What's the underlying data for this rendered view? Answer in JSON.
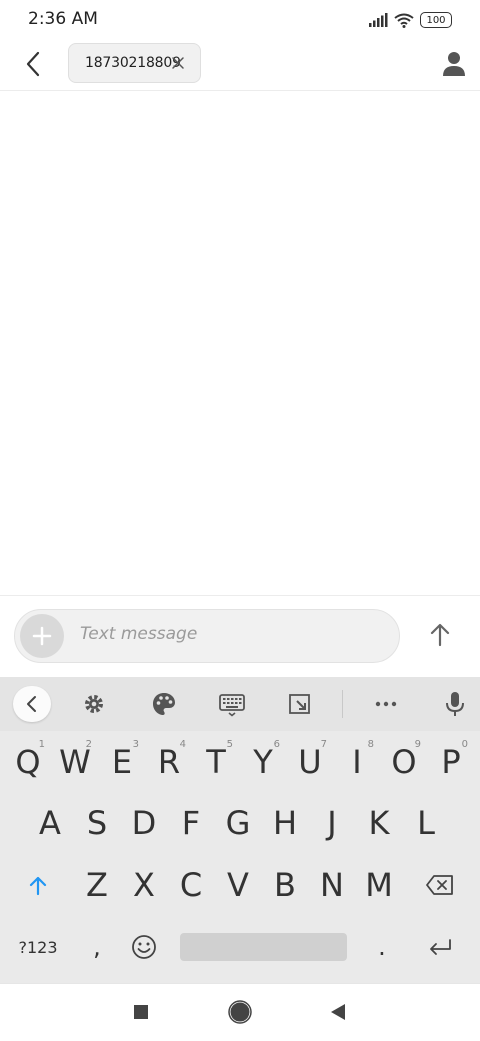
{
  "status_bar": {
    "time": "2:36 AM",
    "battery": "100"
  },
  "header": {
    "recipient": "18730218809"
  },
  "compose": {
    "placeholder": "Text message"
  },
  "keyboard": {
    "row1": [
      {
        "key": "Q",
        "hint": "1"
      },
      {
        "key": "W",
        "hint": "2"
      },
      {
        "key": "E",
        "hint": "3"
      },
      {
        "key": "R",
        "hint": "4"
      },
      {
        "key": "T",
        "hint": "5"
      },
      {
        "key": "Y",
        "hint": "6"
      },
      {
        "key": "U",
        "hint": "7"
      },
      {
        "key": "I",
        "hint": "8"
      },
      {
        "key": "O",
        "hint": "9"
      },
      {
        "key": "P",
        "hint": "0"
      }
    ],
    "row2": [
      "A",
      "S",
      "D",
      "F",
      "G",
      "H",
      "J",
      "K",
      "L"
    ],
    "row3": [
      "Z",
      "X",
      "C",
      "V",
      "B",
      "N",
      "M"
    ],
    "symbols_label": "?123",
    "comma": ",",
    "period": "."
  },
  "colors": {
    "accent": "#2196F3",
    "keyboard_bg": "#eaeaea"
  }
}
